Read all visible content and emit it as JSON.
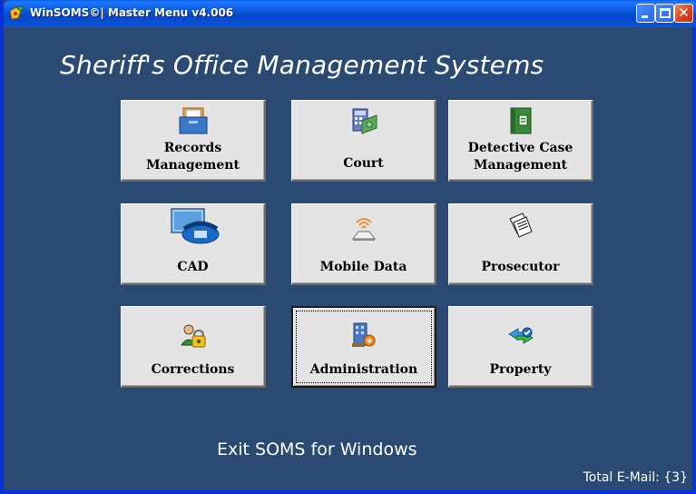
{
  "window": {
    "title": "WinSOMS©| Master Menu v4.006",
    "close_glyph": "✕"
  },
  "heading": "Sheriff's Office Management Systems",
  "tiles": [
    {
      "line1": "Records",
      "line2": "Management",
      "icon": "folder-files-icon"
    },
    {
      "line1": "",
      "line2": "Court",
      "icon": "calculator-money-icon"
    },
    {
      "line1": "Detective Case",
      "line2": "Management",
      "icon": "green-case-book-icon"
    },
    {
      "line1": "",
      "line2": "CAD",
      "icon": "computer-telephone-icon"
    },
    {
      "line1": "",
      "line2": "Mobile Data",
      "icon": "wireless-device-icon"
    },
    {
      "line1": "",
      "line2": "Prosecutor",
      "icon": "documents-icon"
    },
    {
      "line1": "",
      "line2": "Corrections",
      "icon": "person-padlock-icon"
    },
    {
      "line1": "",
      "line2": "Administration",
      "icon": "building-gear-icon"
    },
    {
      "line1": "",
      "line2": "Property",
      "icon": "property-transfer-icon"
    }
  ],
  "focused_tile": "Administration",
  "footer": {
    "exit_label": "Exit SOMS for Windows",
    "email_status": "Total E-Mail: {3}"
  },
  "colors": {
    "background": "#2a4a73",
    "titlebar": "#0a55db",
    "tile": "#e4e4e4",
    "text_light": "#ffffff"
  }
}
